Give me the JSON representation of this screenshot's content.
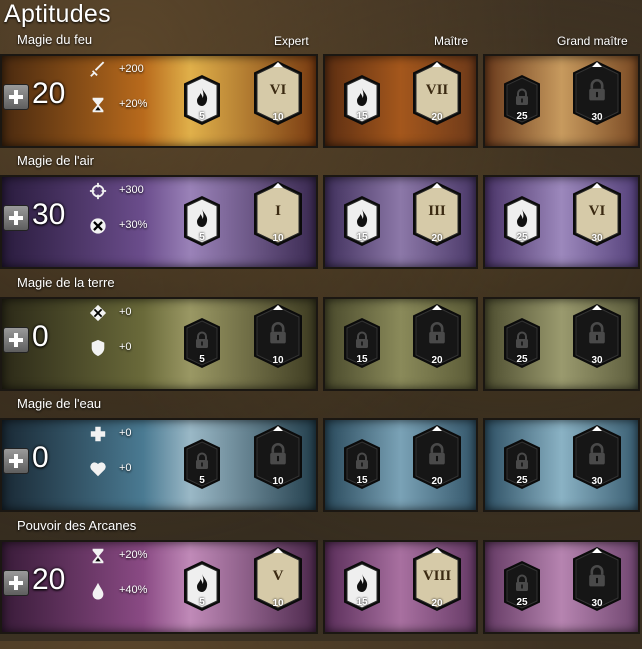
{
  "page_title": "Aptitudes",
  "tiers": [
    "Expert",
    "Maître",
    "Grand maître"
  ],
  "colors": {
    "unlocked_minor": "#efefef",
    "unlocked_major": "#d6caa8",
    "locked": "#161616",
    "icon_black": "#111111"
  },
  "lines": [
    {
      "name": "Magie du feu",
      "points": "20",
      "theme": "fire",
      "stat1": {
        "icon": "sword-icon",
        "value": "+200"
      },
      "stat2": {
        "icon": "hourglass-icon",
        "value": "+20%"
      },
      "slots": [
        {
          "kind": "minor",
          "state": "unlocked",
          "icon": "fire-icon",
          "count": "5"
        },
        {
          "kind": "major",
          "state": "unlocked",
          "label": "VI",
          "count": "10"
        },
        {
          "kind": "minor",
          "state": "unlocked",
          "icon": "fire-icon",
          "count": "15"
        },
        {
          "kind": "major",
          "state": "unlocked",
          "label": "VII",
          "count": "20"
        },
        {
          "kind": "minor",
          "state": "locked",
          "icon": "lock-icon",
          "count": "25"
        },
        {
          "kind": "major",
          "state": "locked",
          "icon": "lock-icon",
          "count": "30"
        }
      ]
    },
    {
      "name": "Magie de l'air",
      "points": "30",
      "theme": "air",
      "stat1": {
        "icon": "crosshair-icon",
        "value": "+300"
      },
      "stat2": {
        "icon": "critical-damage-icon",
        "value": "+30%"
      },
      "slots": [
        {
          "kind": "minor",
          "state": "unlocked",
          "icon": "fire-icon",
          "count": "5"
        },
        {
          "kind": "major",
          "state": "unlocked",
          "label": "I",
          "count": "10"
        },
        {
          "kind": "minor",
          "state": "unlocked",
          "icon": "fire-icon",
          "count": "15"
        },
        {
          "kind": "major",
          "state": "unlocked",
          "label": "III",
          "count": "20"
        },
        {
          "kind": "minor",
          "state": "unlocked",
          "icon": "fire-icon",
          "count": "25"
        },
        {
          "kind": "major",
          "state": "unlocked",
          "label": "VI",
          "count": "30"
        }
      ]
    },
    {
      "name": "Magie de la terre",
      "points": "0",
      "theme": "earth",
      "stat1": {
        "icon": "toughness-icon",
        "value": "+0"
      },
      "stat2": {
        "icon": "shield-icon",
        "value": "+0"
      },
      "slots": [
        {
          "kind": "minor",
          "state": "locked",
          "icon": "lock-icon",
          "count": "5"
        },
        {
          "kind": "major",
          "state": "locked",
          "icon": "lock-icon",
          "count": "10"
        },
        {
          "kind": "minor",
          "state": "locked",
          "icon": "lock-icon",
          "count": "15"
        },
        {
          "kind": "major",
          "state": "locked",
          "icon": "lock-icon",
          "count": "20"
        },
        {
          "kind": "minor",
          "state": "locked",
          "icon": "lock-icon",
          "count": "25"
        },
        {
          "kind": "major",
          "state": "locked",
          "icon": "lock-icon",
          "count": "30"
        }
      ]
    },
    {
      "name": "Magie de l'eau",
      "points": "0",
      "theme": "water",
      "stat1": {
        "icon": "healing-cross-icon",
        "value": "+0"
      },
      "stat2": {
        "icon": "heart-icon",
        "value": "+0"
      },
      "slots": [
        {
          "kind": "minor",
          "state": "locked",
          "icon": "lock-icon",
          "count": "5"
        },
        {
          "kind": "major",
          "state": "locked",
          "icon": "lock-icon",
          "count": "10"
        },
        {
          "kind": "minor",
          "state": "locked",
          "icon": "lock-icon",
          "count": "15"
        },
        {
          "kind": "major",
          "state": "locked",
          "icon": "lock-icon",
          "count": "20"
        },
        {
          "kind": "minor",
          "state": "locked",
          "icon": "lock-icon",
          "count": "25"
        },
        {
          "kind": "major",
          "state": "locked",
          "icon": "lock-icon",
          "count": "30"
        }
      ]
    },
    {
      "name": "Pouvoir des Arcanes",
      "points": "20",
      "theme": "arcane",
      "stat1": {
        "icon": "hourglass-icon",
        "value": "+20%"
      },
      "stat2": {
        "icon": "droplet-icon",
        "value": "+40%"
      },
      "slots": [
        {
          "kind": "minor",
          "state": "unlocked",
          "icon": "fire-icon",
          "count": "5"
        },
        {
          "kind": "major",
          "state": "unlocked",
          "label": "V",
          "count": "10"
        },
        {
          "kind": "minor",
          "state": "unlocked",
          "icon": "fire-icon",
          "count": "15"
        },
        {
          "kind": "major",
          "state": "unlocked",
          "label": "VIII",
          "count": "20"
        },
        {
          "kind": "minor",
          "state": "locked",
          "icon": "lock-icon",
          "count": "25"
        },
        {
          "kind": "major",
          "state": "locked",
          "icon": "lock-icon",
          "count": "30"
        }
      ]
    }
  ]
}
